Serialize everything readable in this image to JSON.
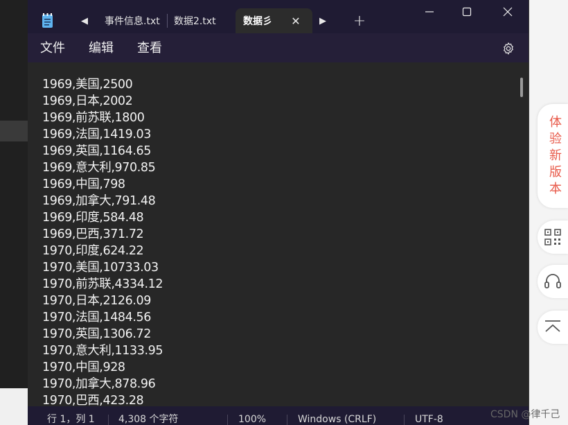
{
  "tabs": [
    {
      "label": "事件信息.txt",
      "active": false
    },
    {
      "label": "数据2.txt",
      "active": false
    },
    {
      "label": "数据彡",
      "active": true
    }
  ],
  "menu": [
    "文件",
    "编辑",
    "查看"
  ],
  "lines": [
    "1969,美国,2500",
    "1969,日本,2002",
    "1969,前苏联,1800",
    "1969,法国,1419.03",
    "1969,英国,1164.65",
    "1969,意大利,970.85",
    "1969,中国,798",
    "1969,加拿大,791.48",
    "1969,印度,584.48",
    "1969,巴西,371.72",
    "1970,印度,624.22",
    "1970,美国,10733.03",
    "1970,前苏联,4334.12",
    "1970,日本,2126.09",
    "1970,法国,1484.56",
    "1970,英国,1306.72",
    "1970,意大利,1133.95",
    "1970,中国,928",
    "1970,加拿大,878.96",
    "1970,巴西,423.28"
  ],
  "status": {
    "position": "行 1，列 1",
    "chars": "4,308 个字符",
    "zoom": "100%",
    "line_ending": "Windows (CRLF)",
    "encoding": "UTF-8"
  },
  "side_panel": {
    "new_version": "体验新版本"
  },
  "watermark": "CSDN @律千己",
  "colors": {
    "titlebar": "#1f1b33",
    "editor_bg": "#272727",
    "side_accent": "#e85a4a"
  }
}
